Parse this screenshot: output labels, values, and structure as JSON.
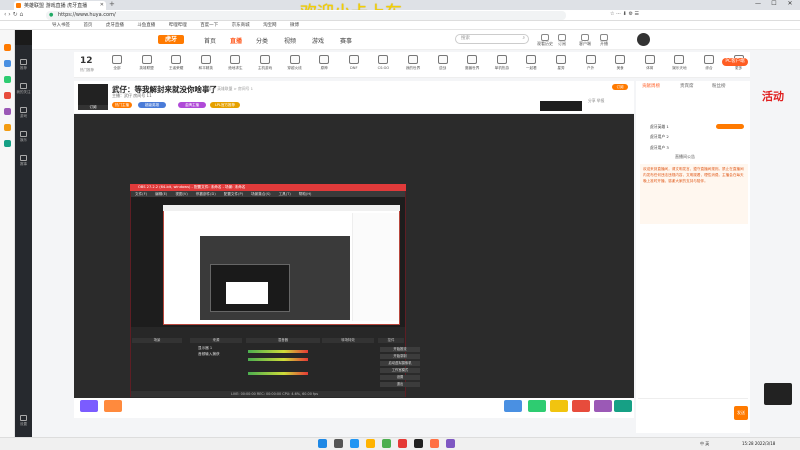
{
  "overlay_text": "欢迎小卡上车",
  "tab": {
    "title": "英雄联盟 游戏直播 虎牙直播"
  },
  "window_controls": [
    "—",
    "☐",
    "✕"
  ],
  "address": {
    "url": "https://www.huya.com/"
  },
  "bookmarks": [
    "导入书签",
    "首页",
    "虎牙直播",
    "斗鱼直播",
    "哔哩哔哩",
    "百度一下",
    "京东商城",
    "淘宝网",
    "微博"
  ],
  "top_nav": {
    "logo": "虎牙",
    "items": [
      "首页",
      "直播",
      "分类",
      "视频",
      "游戏",
      "赛事"
    ],
    "search_placeholder": "搜索",
    "icons": [
      {
        "name": "history",
        "label": "观看历史"
      },
      {
        "name": "subscribe",
        "label": "订阅"
      },
      {
        "name": "client",
        "label": "客户端"
      },
      {
        "name": "start-live",
        "label": "开播"
      }
    ]
  },
  "categories": {
    "count": "12",
    "count_label": "热门推荐",
    "items": [
      "全部",
      "英雄联盟",
      "王者荣耀",
      "和平精英",
      "绝地求生",
      "主机游戏",
      "穿越火线",
      "原神",
      "DNF",
      "CS:GO",
      "我的世界",
      "逆战",
      "魔兽世界",
      "单机热游",
      "一起看",
      "星秀",
      "户外",
      "美食",
      "体育",
      "娱乐天地",
      "综合",
      "更多"
    ],
    "pc_badge": "PC客户端"
  },
  "room": {
    "title": "武仔：等我解封来就没你啥事了",
    "crumb": "网游 > 英雄联盟 > 房间号 1",
    "meta": "主播：武仔  房间号 11",
    "badges": [
      "热门主播",
      "超级英雄",
      "金牌主播",
      "LPL官方推荐"
    ],
    "follow": "订阅",
    "report": "分享  举报"
  },
  "obs": {
    "title": "OBS 27.2.2 (64-bit, windows) - 配置文件: 未命名 - 场景: 未命名",
    "menu": [
      "文件(F)",
      "编辑(E)",
      "视图(V)",
      "停靠部件(D)",
      "配置文件(P)",
      "场景集合(S)",
      "工具(T)",
      "帮助(H)"
    ],
    "dock_labels": [
      "场景",
      "来源",
      "混音器",
      "转场特效",
      "控件"
    ],
    "sources": [
      "显示器 1",
      "音频输入捕获"
    ],
    "controls": [
      "开始推流",
      "开始录制",
      "启动虚拟摄像机",
      "工作室模式",
      "设置",
      "退出"
    ],
    "status": "LIVE: 00:00:00   REC: 00:00:00   CPU: 4.6%, 60.00 fps"
  },
  "rpanel": {
    "tabs": [
      "贡献周榜",
      "贵宾席",
      "粉丝榜"
    ],
    "rows": [
      "虎牙英雄 1",
      "虎牙用户 2",
      "虎牙用户 3"
    ],
    "notice_title": "直播间公告",
    "notice": "欢迎来到直播间，请文明发言，遵守直播间规则。禁止在直播间内发布任何违法违规内容，文明观看，理性消费。主播会在每天晚上准时开播，感谢大家的支持与陪伴。",
    "send_label": "发送",
    "ad": "活动"
  },
  "taskbar": {
    "time": "15:28",
    "date": "2022/3/18",
    "tray": "中 英"
  },
  "lnav": [
    "推荐",
    "我的关注",
    "游戏",
    "娱乐",
    "赛事",
    "设置"
  ]
}
